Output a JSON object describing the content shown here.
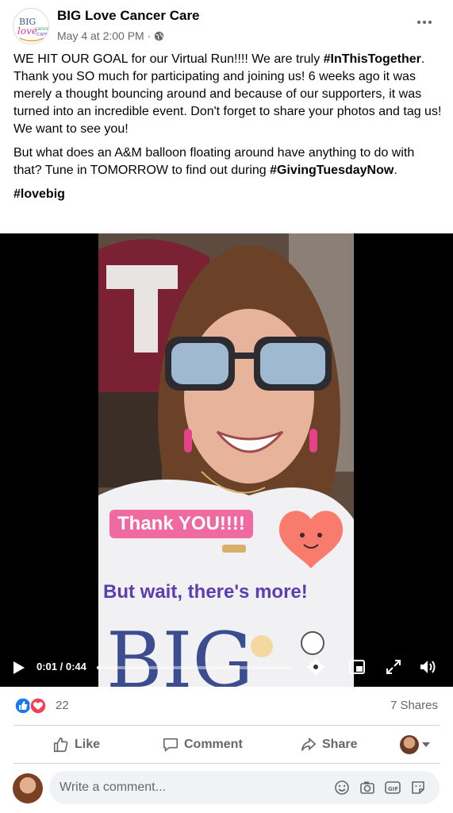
{
  "post": {
    "page_name": "BIG Love Cancer Care",
    "timestamp": "May 4 at 2:00 PM",
    "separator": "·",
    "privacy_icon": "globe-icon",
    "more_icon": "more-horizontal-icon",
    "logo": {
      "line1": "BIG",
      "line2": "love",
      "line3": "cancer",
      "line4": "care"
    }
  },
  "text": {
    "p1_a": "WE HIT OUR GOAL for our Virtual Run!!!! We are truly ",
    "p1_tag": "#InThisTogether",
    "p1_b": ". Thank you SO much for participating and joining us! 6 weeks ago it was merely a thought bouncing around and because of our supporters, it was turned into an incredible event. Don't forget to share your photos and tag us! We want to see you!",
    "p2_a": "But what does an A&M balloon floating around have anything to do with that? Tune in TOMORROW to find out during ",
    "p2_tag": "#GivingTuesdayNow",
    "p2_b": ".",
    "p3_tag": "#lovebig"
  },
  "video": {
    "overlay_thank": "Thank YOU!!!!",
    "overlay_wait": "But wait, there's more!",
    "time": "0:01 / 0:44",
    "progress": 0.023
  },
  "reactions": {
    "count": "22",
    "shares": "7 Shares",
    "types": [
      "like-reaction-icon",
      "love-reaction-icon"
    ]
  },
  "actions": {
    "like": "Like",
    "comment": "Comment",
    "share": "Share"
  },
  "comment": {
    "placeholder": "Write a comment..."
  },
  "colors": {
    "like_blue": "#1877f2",
    "love_red": "#f33e58",
    "secondary_text": "#65676b",
    "overlay_pink": "#f06aa2",
    "overlay_purple": "#5b3fb0"
  }
}
